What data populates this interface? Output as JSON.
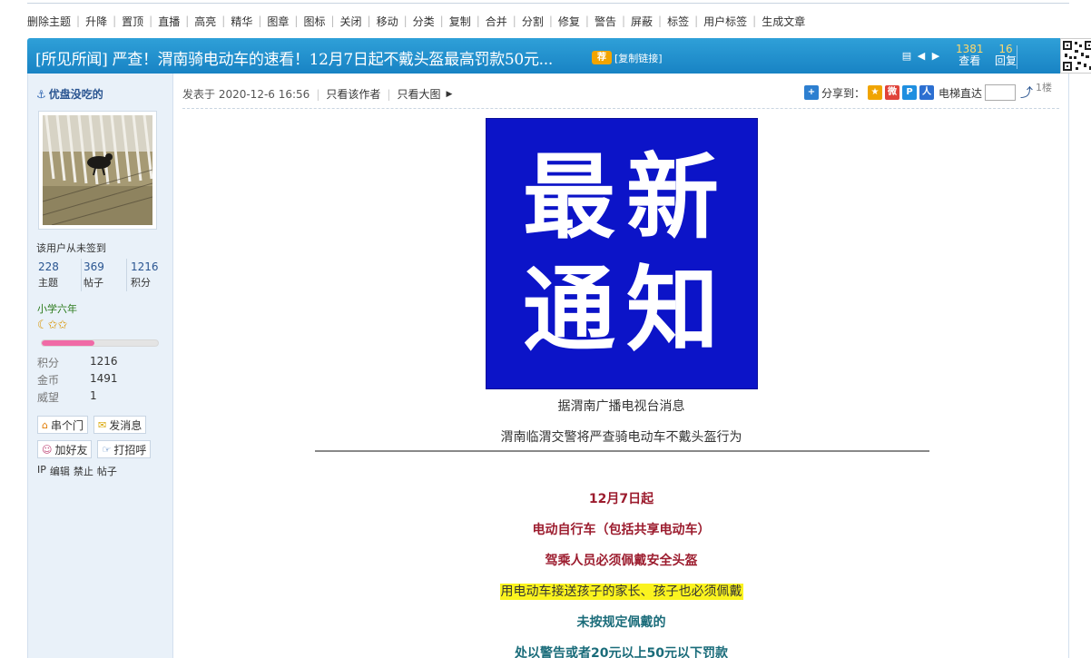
{
  "admin_toolbar": [
    "删除主题",
    "升降",
    "置顶",
    "直播",
    "高亮",
    "精华",
    "图章",
    "图标",
    "关闭",
    "移动",
    "分类",
    "复制",
    "合并",
    "分割",
    "修复",
    "警告",
    "屏蔽",
    "标签",
    "用户标签",
    "生成文章"
  ],
  "thread": {
    "title": "[所见所闻] 严查！渭南骑电动车的速看！12月7日起不戴头盔最高罚款50元...",
    "rec_badge": "荐",
    "copy_link": "[复制链接]",
    "views": "1381",
    "views_label": "查看",
    "replies": "16",
    "replies_label": "回复"
  },
  "user": {
    "name": "优盘没吃的",
    "signin": "该用户从未签到",
    "threads": "228",
    "threads_label": "主题",
    "posts": "369",
    "posts_label": "帖子",
    "credits": "1216",
    "credits_label": "积分",
    "rank": "小学六年",
    "stars": "☾✩✩",
    "level_progress": 0.45,
    "info": [
      {
        "k": "积分",
        "v": "1216"
      },
      {
        "k": "金币",
        "v": "1491"
      },
      {
        "k": "威望",
        "v": "1"
      }
    ],
    "buttons": [
      "串个门",
      "发消息",
      "加好友",
      "打招呼"
    ],
    "admin_links": [
      "IP",
      "编辑",
      "禁止",
      "帖子"
    ]
  },
  "post": {
    "posted_at": "发表于 2020-12-6 16:56",
    "only_author": "只看该作者",
    "only_images": "只看大图",
    "share_label": "分享到：",
    "elevator_label": "电梯直达",
    "floor": "1楼",
    "notice_line1": "最新",
    "notice_line2": "通知",
    "caption1": "据渭南广播电视台消息",
    "caption2": "渭南临渭交警将严查骑电动车不戴头盔行为",
    "body": [
      {
        "text": "12月7日起",
        "style": "red"
      },
      {
        "text": "电动自行车（包括共享电动车）",
        "style": "red"
      },
      {
        "text": "驾乘人员必须佩戴安全头盔",
        "style": "red"
      },
      {
        "text": "用电动车接送孩子的家长、孩子也必须佩戴",
        "style": "highlight"
      },
      {
        "text": "未按规定佩戴的",
        "style": "teal"
      },
      {
        "text": "处以警告或者20元以上50元以下罚款",
        "style": "teal"
      }
    ]
  },
  "colors": {
    "title_bar": "#1883c4",
    "notice_bg": "#0c14c8",
    "red_text": "#9c1c2e",
    "teal_text": "#1a6c7a",
    "highlight": "#fbf31f"
  }
}
